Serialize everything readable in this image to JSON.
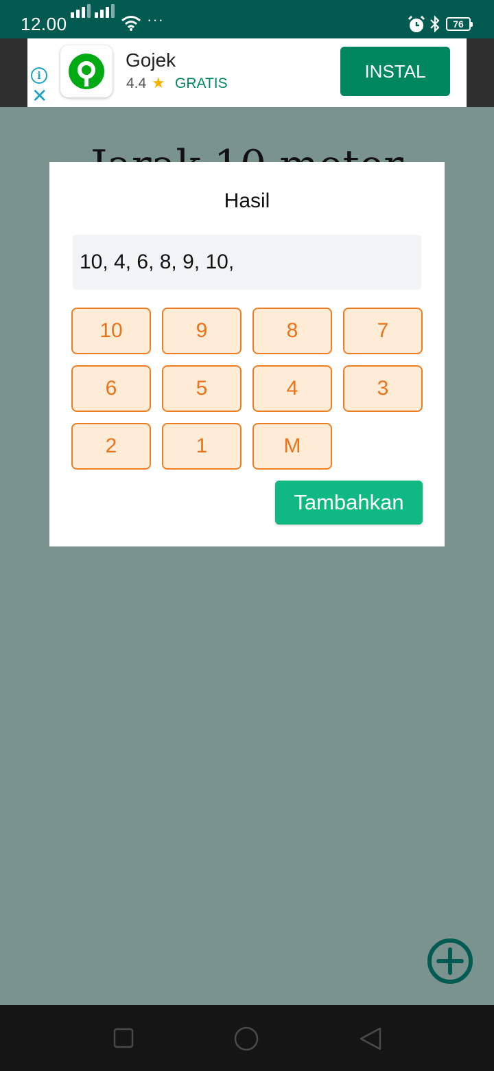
{
  "status_bar": {
    "time": "12.00",
    "more": "···",
    "battery_level": "76",
    "icons": [
      "signal-icon",
      "signal-icon",
      "wifi-icon",
      "alarm-icon",
      "bluetooth-icon",
      "battery-icon"
    ]
  },
  "ad": {
    "app_name": "Gojek",
    "rating": "4.4",
    "star": "★",
    "price": "GRATIS",
    "install_label": "INSTAL",
    "info_glyph": "i",
    "close_glyph": "✕",
    "brand_color": "#00aa13",
    "install_color": "#01875f"
  },
  "background": {
    "title": "Jarak 10 meter"
  },
  "dialog": {
    "title": "Hasil",
    "result_value": "10, 4, 6, 8, 9, 10,",
    "score_buttons": [
      "10",
      "9",
      "8",
      "7",
      "6",
      "5",
      "4",
      "3",
      "2",
      "1",
      "M"
    ],
    "submit_label": "Tambahkan",
    "accent_color": "#ef7d22",
    "submit_color": "#10b981"
  },
  "fab": {
    "icon": "add-circle-icon",
    "color": "#035a51"
  },
  "nav_bar": {
    "buttons": [
      "recents-icon",
      "home-icon",
      "back-icon"
    ]
  }
}
